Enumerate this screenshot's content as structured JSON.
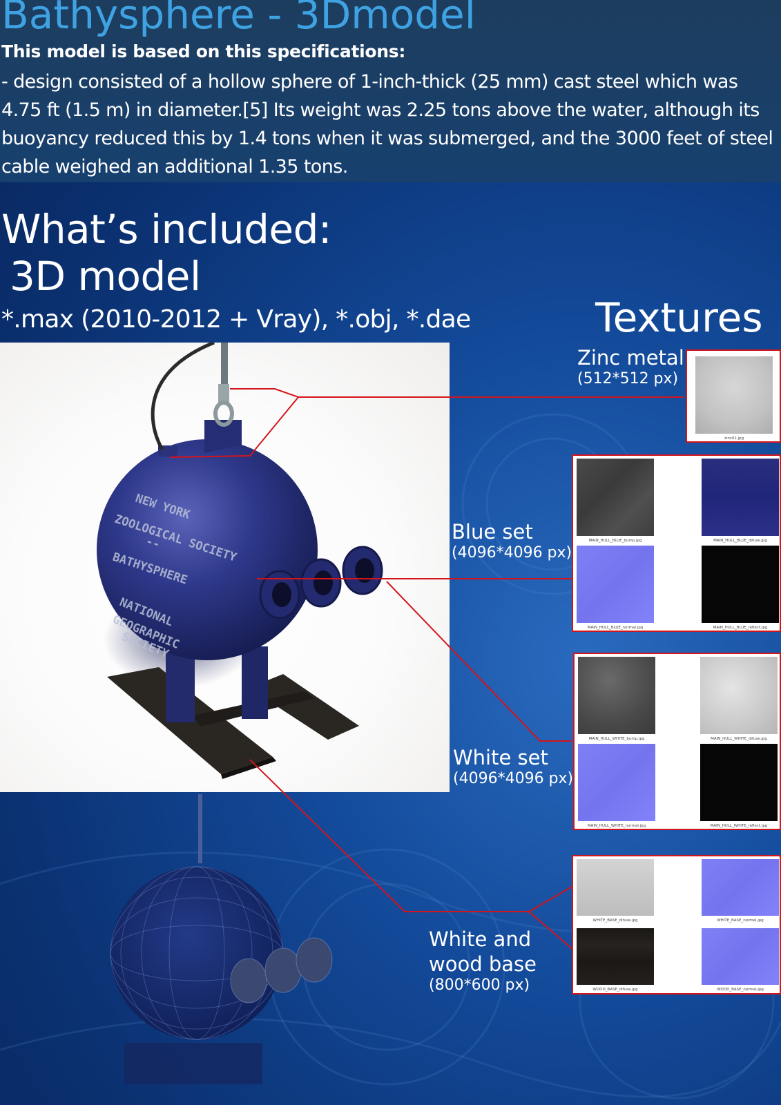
{
  "header": {
    "title": "Bathysphere - 3Dmodel",
    "spec_heading": "This model is based on this specifications:",
    "spec_text": "- design consisted of a hollow sphere of 1-inch-thick (25 mm) cast steel which was 4.75 ft (1.5 m) in diameter.[5] Its weight was 2.25 tons above the water, although its buoyancy reduced this by 1.4 tons when it was submerged, and the 3000 feet of steel cable weighed an additional 1.35 tons."
  },
  "included": {
    "heading": "What’s included:",
    "model_heading": " 3D model",
    "formats": "*.max (2010-2012 + Vray), *.obj, *.dae"
  },
  "model_render": {
    "hull_text": [
      "NEW YORK",
      "ZOOLOGICAL SOCIETY",
      "--",
      "BATHYSPHERE",
      "NATIONAL",
      "GEOGRAPHIC",
      "SOCIETY"
    ]
  },
  "textures": {
    "heading": "Textures",
    "zinc": {
      "name": "Zinc metal",
      "size": "(512*512 px)",
      "files": [
        "zinc01.jpg"
      ]
    },
    "blue_set": {
      "name": "Blue set",
      "size": "(4096*4096 px)",
      "files": [
        "MAIN_HULL_BLUE_bump.jpg",
        "MAIN_HULL_BLUE_difuse.jpg",
        "MAIN_HULL_BLUE_normal.jpg",
        "MAIN_HULL_BLUE_reflect.jpg"
      ]
    },
    "white_set": {
      "name": "White set",
      "size": "(4096*4096 px)",
      "files": [
        "MAIN_HULL_WHITE_bump.jpg",
        "MAIN_HULL_WHITE_difuse.jpg",
        "MAIN_HULL_WHITE_normal.jpg",
        "MAIN_HULL_WHITE_reflect.jpg"
      ]
    },
    "base_set": {
      "name_line1": "White and",
      "name_line2": "wood base",
      "size": "(800*600 px)",
      "files": [
        "WHITE_BASE_difuse.jpg",
        "WHITE_BASE_normal.jpg",
        "WOOD_BASE_difuse.jpg",
        "WOOD_BASE_normal.jpg"
      ]
    }
  },
  "colors": {
    "title": "#3fa2e2",
    "connector": "#d4141b",
    "hull": "#2b3580"
  }
}
